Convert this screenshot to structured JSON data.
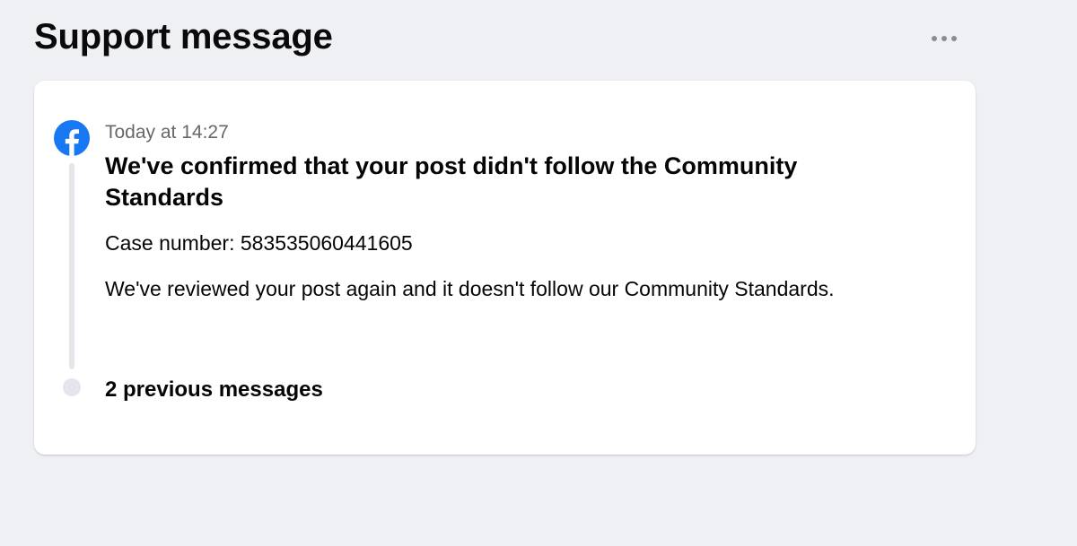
{
  "page": {
    "title": "Support message",
    "more_options_icon": "more-horizontal-icon"
  },
  "message": {
    "sender_icon": "facebook-logo-icon",
    "timestamp": "Today at 14:27",
    "title": "We've confirmed that your post didn't follow the Community Standards",
    "case_number": "Case number: 583535060441605",
    "body": "We've reviewed your post again and it doesn't follow our Community Standards."
  },
  "previous": {
    "label": "2 previous messages"
  },
  "colors": {
    "background": "#eff0f4",
    "card": "#ffffff",
    "facebook_blue": "#1877f2",
    "secondary_text": "#65676b",
    "timeline": "#e4e6eb"
  }
}
